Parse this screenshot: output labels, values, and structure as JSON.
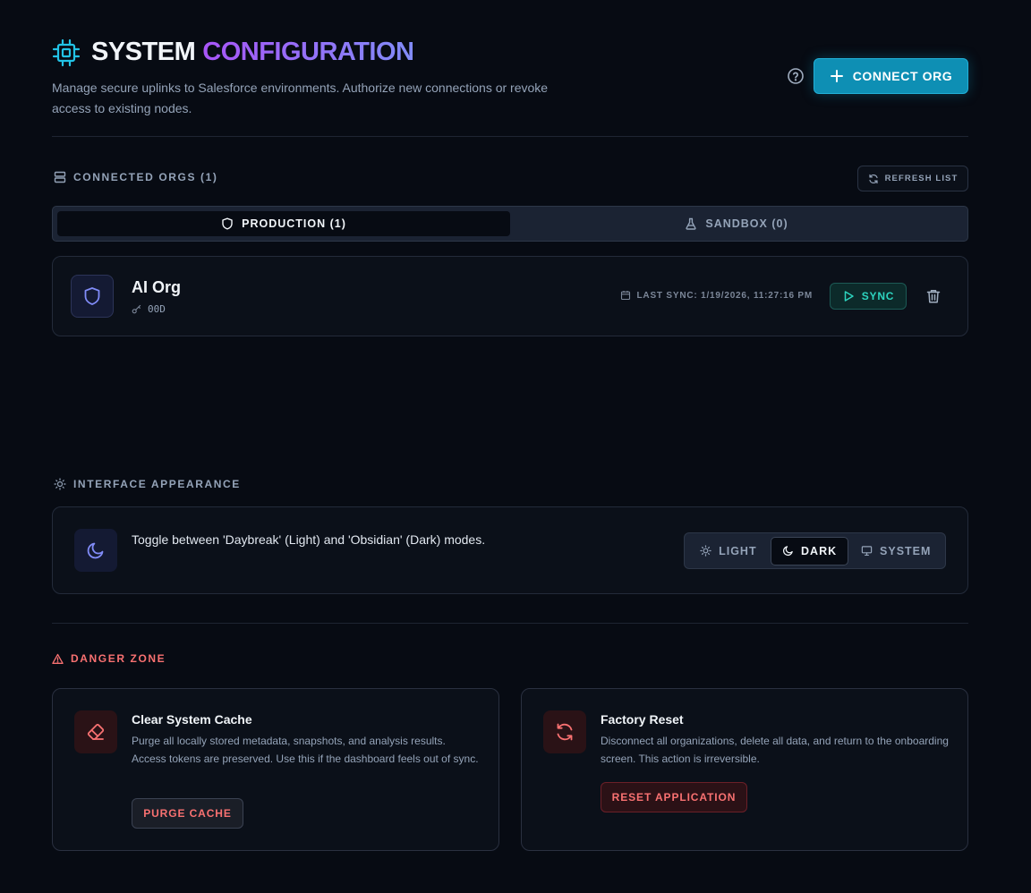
{
  "header": {
    "title_part1": "SYSTEM",
    "title_part2": "CONFIGURATION",
    "subtitle": "Manage secure uplinks to Salesforce environments. Authorize new connections or revoke access to existing nodes.",
    "connect_label": "CONNECT ORG",
    "help_icon": "help-circle-icon"
  },
  "orgs": {
    "section_label": "CONNECTED ORGS (1)",
    "refresh_label": "REFRESH LIST",
    "tabs": [
      {
        "label": "PRODUCTION (1)",
        "icon": "shield-icon",
        "active": true
      },
      {
        "label": "SANDBOX (0)",
        "icon": "flask-icon",
        "active": false
      }
    ],
    "items": [
      {
        "name": "AI Org",
        "org_id": "00D",
        "last_sync": "LAST SYNC: 1/19/2026, 11:27:16 PM",
        "sync_label": "SYNC"
      }
    ]
  },
  "appearance": {
    "section_label": "INTERFACE APPEARANCE",
    "description": "Toggle between 'Daybreak' (Light) and 'Obsidian' (Dark) modes.",
    "options": [
      {
        "label": "LIGHT",
        "icon": "sun-icon"
      },
      {
        "label": "DARK",
        "icon": "moon-icon"
      },
      {
        "label": "SYSTEM",
        "icon": "monitor-icon"
      }
    ],
    "selected": "DARK"
  },
  "danger": {
    "section_label": "DANGER ZONE",
    "cards": [
      {
        "title": "Clear System Cache",
        "description": "Purge all locally stored metadata, snapshots, and analysis results. Access tokens are preserved. Use this if the dashboard feels out of sync.",
        "button_label": "PURGE CACHE",
        "icon": "eraser-icon"
      },
      {
        "title": "Factory Reset",
        "description": "Disconnect all organizations, delete all data, and return to the onboarding screen. This action is irreversible.",
        "button_label": "RESET APPLICATION",
        "icon": "refresh-icon"
      }
    ]
  },
  "colors": {
    "background": "#070b13",
    "accent_cyan": "#0e8fb4",
    "accent_purple": "#a855f7",
    "teal": "#2dd4bf",
    "danger": "#f87171"
  }
}
